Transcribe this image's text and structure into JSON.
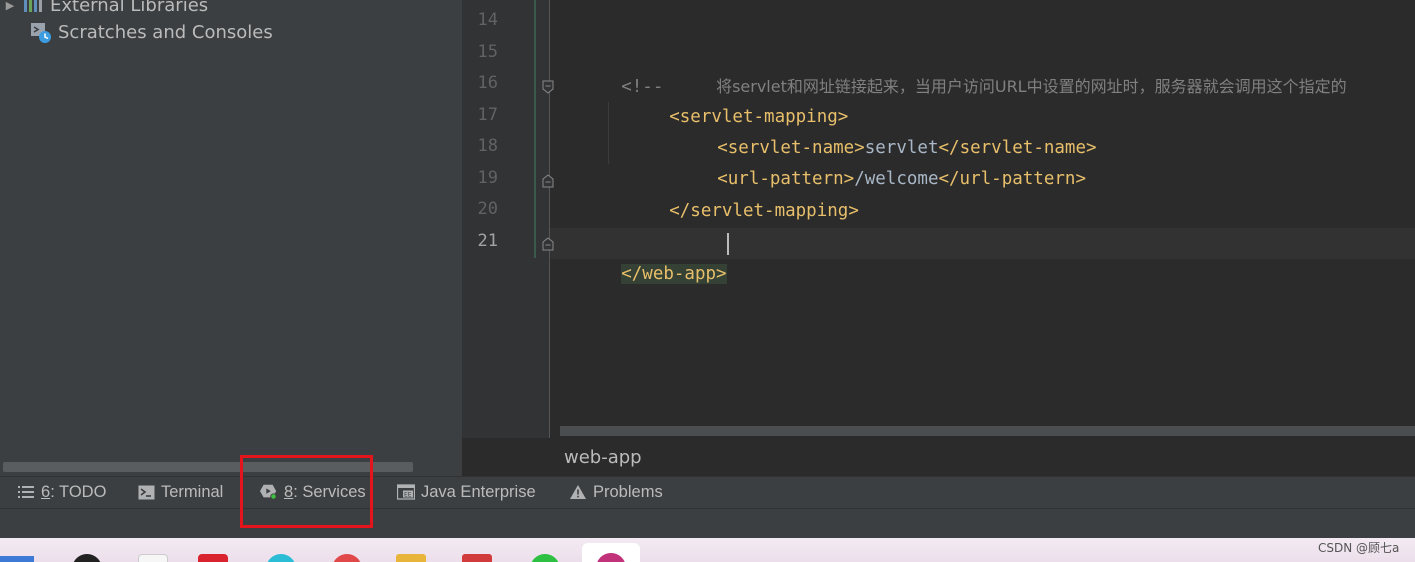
{
  "project_tree": {
    "items": [
      {
        "label": "External Libraries",
        "icon": "library-icon",
        "arrow": "▶"
      },
      {
        "label": "Scratches and Consoles",
        "icon": "scratches-icon"
      }
    ]
  },
  "editor": {
    "line_numbers": [
      "14",
      "15",
      "16",
      "17",
      "18",
      "19",
      "20",
      "21"
    ],
    "current_line": "21",
    "lines": {
      "l15_open": "<!--",
      "l15_text": "将servlet和网址链接起来，当用户访问URL中设置的网址时，服务器就会调用这个指定的",
      "l16": "<servlet-mapping>",
      "l17_open": "<servlet-name>",
      "l17_value": "servlet",
      "l17_close": "</servlet-name>",
      "l18_open": "<url-pattern>",
      "l18_value": "/welcome",
      "l18_close": "</url-pattern>",
      "l19": "</servlet-mapping>",
      "l21": "</web-app>"
    },
    "breadcrumb": "web-app"
  },
  "tool_bar": {
    "todo": {
      "num": "6",
      "label": ": TODO"
    },
    "terminal": {
      "label": "Terminal"
    },
    "services": {
      "num": "8",
      "label": ": Services"
    },
    "java_enterprise": {
      "label": "Java Enterprise"
    },
    "problems": {
      "label": "Problems"
    }
  },
  "annotation": {
    "highlight_color": "#e3141b"
  },
  "watermark": "CSDN @顾七a",
  "colors": {
    "tag": "#e8bf6a",
    "text": "#a9b7c6",
    "comment": "#808080",
    "background": "#2b2b2b",
    "panel": "#3c3f41"
  }
}
